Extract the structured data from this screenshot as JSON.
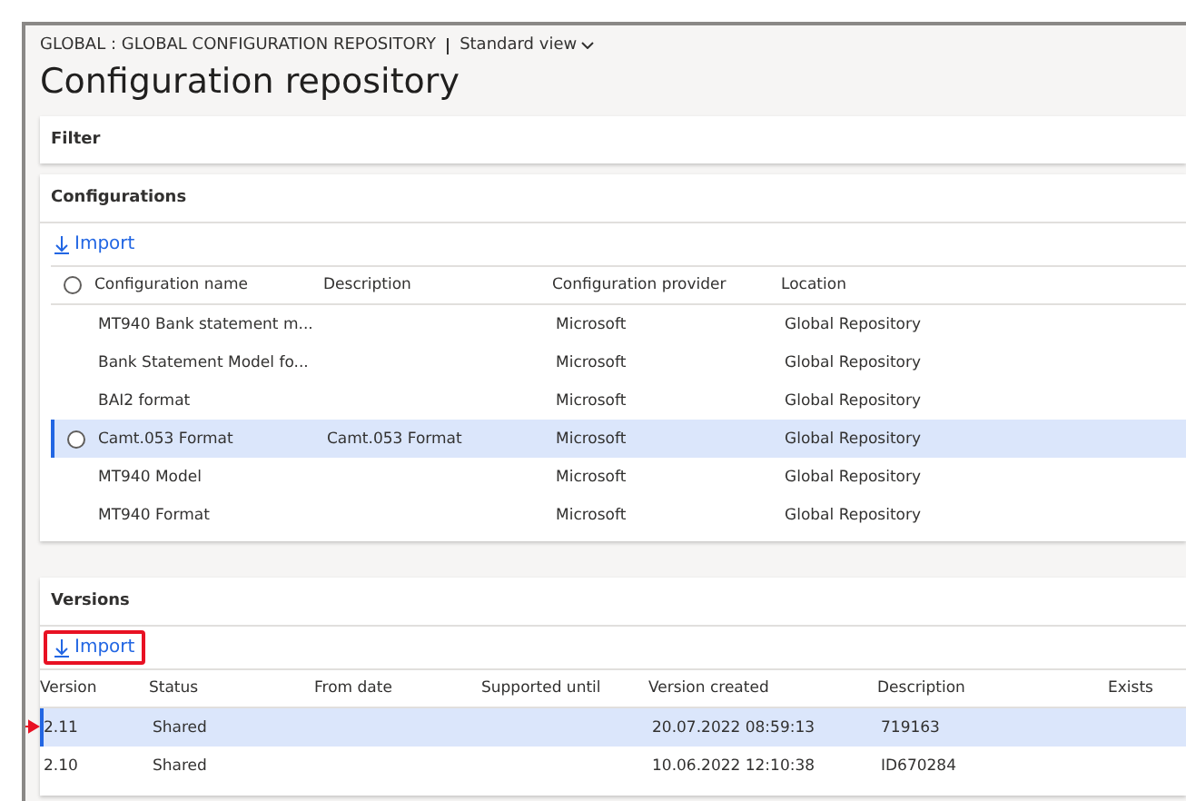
{
  "header": {
    "breadcrumb": "GLOBAL : GLOBAL CONFIGURATION REPOSITORY",
    "view": "Standard view",
    "title": "Configuration repository"
  },
  "filter": {
    "title": "Filter"
  },
  "configurations": {
    "title": "Configurations",
    "import": {
      "label": "Import",
      "highlighted": false
    },
    "select_all_checked": false,
    "columns": [
      "Configuration name",
      "Description",
      "Configuration provider",
      "Location"
    ],
    "rows": [
      {
        "cells": [
          "MT940 Bank statement m...",
          "",
          "Microsoft",
          "Global Repository"
        ],
        "selected": false
      },
      {
        "cells": [
          "Bank Statement Model fo...",
          "",
          "Microsoft",
          "Global Repository"
        ],
        "selected": false
      },
      {
        "cells": [
          "BAI2 format",
          "",
          "Microsoft",
          "Global Repository"
        ],
        "selected": false
      },
      {
        "cells": [
          "Camt.053 Format",
          "Camt.053 Format",
          "Microsoft",
          "Global Repository"
        ],
        "selected": true
      },
      {
        "cells": [
          "MT940 Model",
          "",
          "Microsoft",
          "Global Repository"
        ],
        "selected": false
      },
      {
        "cells": [
          "MT940 Format",
          "",
          "Microsoft",
          "Global Repository"
        ],
        "selected": false
      }
    ]
  },
  "versions": {
    "title": "Versions",
    "import": {
      "label": "Import",
      "highlighted": true
    },
    "columns": [
      "Version",
      "Status",
      "From date",
      "Supported until",
      "Version created",
      "Description",
      "Exists"
    ],
    "rows": [
      {
        "cells": [
          "2.11",
          "Shared",
          "",
          "",
          "20.07.2022 08:59:13",
          "719163",
          ""
        ],
        "selected": true,
        "marked": true
      },
      {
        "cells": [
          "2.10",
          "Shared",
          "",
          "",
          "10.06.2022 12:10:38",
          "ID670284",
          ""
        ],
        "selected": false,
        "marked": false
      }
    ]
  }
}
